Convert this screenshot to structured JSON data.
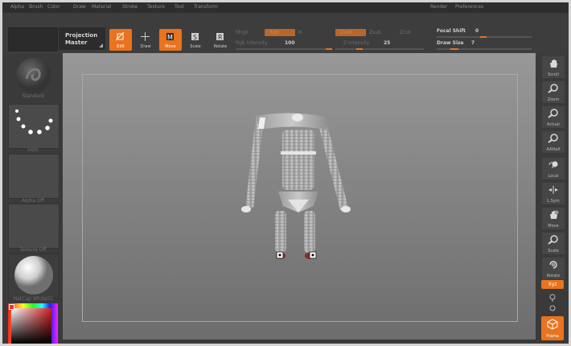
{
  "menu": [
    "Alpha",
    "Brush",
    "Color",
    "Draw",
    "Material",
    "Stroke",
    "Texture",
    "Tool",
    "Transform",
    "Render",
    "Preferences"
  ],
  "projection_master": {
    "line1": "Projection",
    "line2": "Master"
  },
  "tools": [
    {
      "label": "Edit",
      "active": true,
      "icon": "edit-icon"
    },
    {
      "label": "Draw",
      "active": false,
      "icon": "crosshair-icon"
    },
    {
      "label": "Move",
      "active": true,
      "icon": "move-icon"
    },
    {
      "label": "Scale",
      "active": false,
      "icon": "scale-icon"
    },
    {
      "label": "Rotate",
      "active": false,
      "icon": "rotate-icon"
    }
  ],
  "brush": {
    "mrgb": "Mrgb",
    "rgb": "Rgb",
    "m": "M",
    "rgb_intensity_label": "Rgb Intensity",
    "rgb_intensity": "100",
    "zadd": "Zadd",
    "zsub": "Zsub",
    "zcut": "Zcut",
    "z_intensity_label": "Z Intensity",
    "z_intensity": "25",
    "focal_shift_label": "Focal Shift",
    "focal_shift": "0",
    "draw_size_label": "Draw Size",
    "draw_size": "7"
  },
  "left": {
    "standard": "Standard",
    "dots": "Dots",
    "alpha": "Alpha Off",
    "texture": "Texture Off",
    "matcap": "MatCap White01"
  },
  "right": [
    "Scroll",
    "Zoom",
    "Actual",
    "AAHalf",
    "Local",
    "L.Sym",
    "Move",
    "Scale",
    "Rotate",
    "PolyF",
    "Frame"
  ],
  "right_xyz": "Xyz",
  "colors": {
    "accent": "#e9731e",
    "panel": "#3a3a3a"
  }
}
